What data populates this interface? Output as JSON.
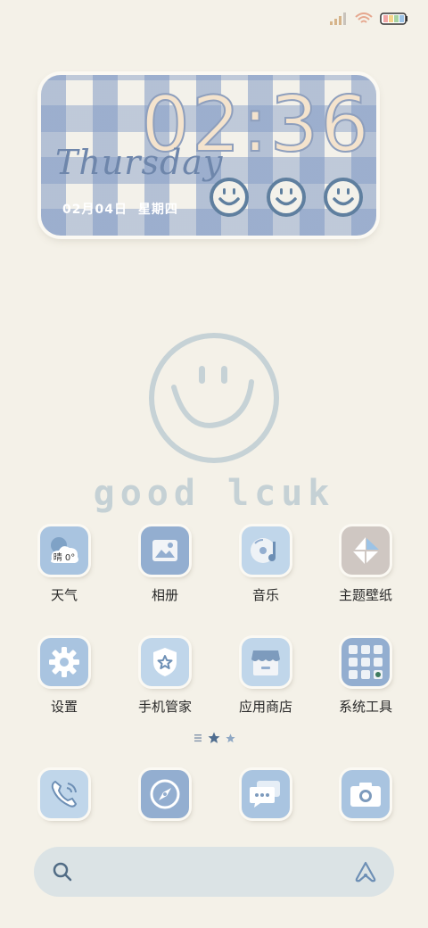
{
  "status_bar": {
    "icons": [
      "signal-icon",
      "wifi-icon",
      "battery-icon"
    ],
    "colors": {
      "signal": "#d6b48a",
      "wifi": "#e6a88f",
      "battery_bars": [
        "#f2a6a6",
        "#f5d38a",
        "#a8d4a3",
        "#9cc3e6"
      ]
    }
  },
  "clock_widget": {
    "time": "02:36",
    "weekday": "Thursday",
    "date": "02月04日 星期四",
    "smiley_count": 3
  },
  "wallpaper": {
    "icon": "smiley-face-icon",
    "text": "good lcuk"
  },
  "apps": [
    {
      "name": "天气",
      "icon": "weather-icon",
      "weather_text": "晴 0°"
    },
    {
      "name": "相册",
      "icon": "gallery-icon"
    },
    {
      "name": "音乐",
      "icon": "music-icon"
    },
    {
      "name": "主题壁纸",
      "icon": "themes-icon"
    },
    {
      "name": "设置",
      "icon": "gear-icon"
    },
    {
      "name": "手机管家",
      "icon": "phone-manager-icon"
    },
    {
      "name": "应用商店",
      "icon": "app-store-icon"
    },
    {
      "name": "系统工具",
      "icon": "system-tools-folder-icon"
    }
  ],
  "pager": {
    "pages": 2,
    "current": 1
  },
  "dock": [
    {
      "icon": "phone-icon"
    },
    {
      "icon": "browser-compass-icon"
    },
    {
      "icon": "messages-icon"
    },
    {
      "icon": "camera-icon"
    }
  ],
  "search_bar": {
    "left_icon": "search-icon",
    "right_icon": "assistant-icon"
  },
  "colors": {
    "background": "#f4f1e8",
    "icon_blue": "#a9c4e0",
    "icon_mid_blue": "#93aed0",
    "accent_dark_blue": "#5f7f9f"
  }
}
